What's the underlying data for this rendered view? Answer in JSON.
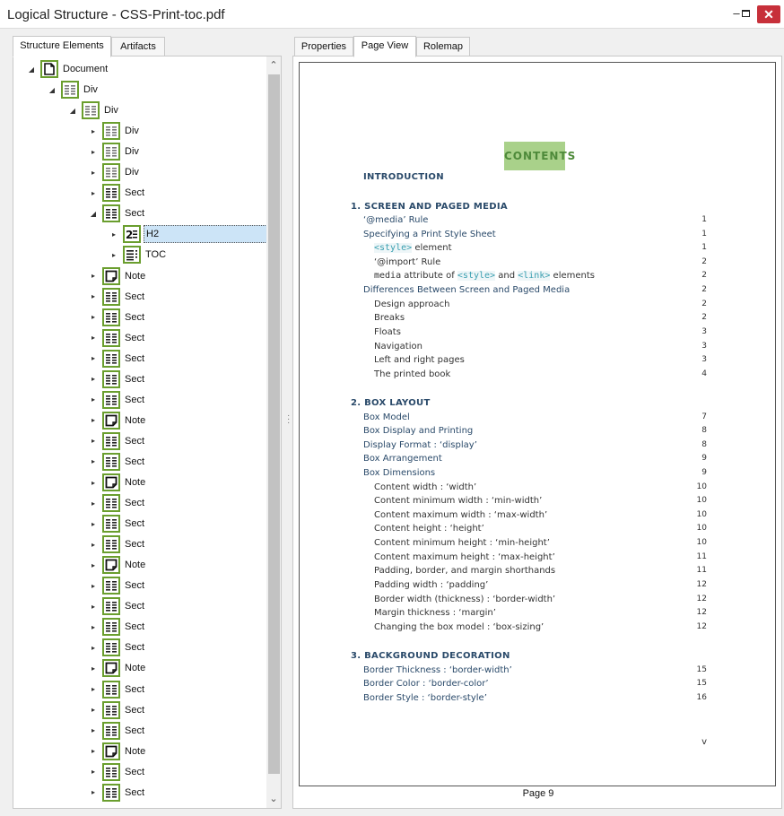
{
  "window": {
    "title": "Logical Structure - CSS-Print-toc.pdf",
    "minimize": "–",
    "close": "✕"
  },
  "left_tabs": [
    "Structure Elements",
    "Artifacts"
  ],
  "right_tabs": [
    "Properties",
    "Page View",
    "Rolemap"
  ],
  "tree": [
    {
      "label": "Document",
      "icon": "document-icon",
      "depth": 0,
      "expander": "◢"
    },
    {
      "label": "Div",
      "icon": "div-icon",
      "depth": 1,
      "expander": "◢"
    },
    {
      "label": "Div",
      "icon": "div-icon",
      "depth": 2,
      "expander": "◢"
    },
    {
      "label": "Div",
      "icon": "div-icon",
      "depth": 3,
      "expander": "▸"
    },
    {
      "label": "Div",
      "icon": "div-icon",
      "depth": 3,
      "expander": "▸"
    },
    {
      "label": "Div",
      "icon": "div-icon",
      "depth": 3,
      "expander": "▸"
    },
    {
      "label": "Sect",
      "icon": "sect-icon",
      "depth": 3,
      "expander": "▸"
    },
    {
      "label": "Sect",
      "icon": "sect-icon",
      "depth": 3,
      "expander": "◢"
    },
    {
      "label": "H2",
      "icon": "heading-icon",
      "depth": 4,
      "expander": "▸",
      "selected": true
    },
    {
      "label": "TOC",
      "icon": "toc-icon",
      "depth": 4,
      "expander": "▸"
    },
    {
      "label": "Note",
      "icon": "note-icon",
      "depth": 3,
      "expander": "▸"
    },
    {
      "label": "Sect",
      "icon": "sect-icon",
      "depth": 3,
      "expander": "▸"
    },
    {
      "label": "Sect",
      "icon": "sect-icon",
      "depth": 3,
      "expander": "▸"
    },
    {
      "label": "Sect",
      "icon": "sect-icon",
      "depth": 3,
      "expander": "▸"
    },
    {
      "label": "Sect",
      "icon": "sect-icon",
      "depth": 3,
      "expander": "▸"
    },
    {
      "label": "Sect",
      "icon": "sect-icon",
      "depth": 3,
      "expander": "▸"
    },
    {
      "label": "Sect",
      "icon": "sect-icon",
      "depth": 3,
      "expander": "▸"
    },
    {
      "label": "Note",
      "icon": "note-icon",
      "depth": 3,
      "expander": "▸"
    },
    {
      "label": "Sect",
      "icon": "sect-icon",
      "depth": 3,
      "expander": "▸"
    },
    {
      "label": "Sect",
      "icon": "sect-icon",
      "depth": 3,
      "expander": "▸"
    },
    {
      "label": "Note",
      "icon": "note-icon",
      "depth": 3,
      "expander": "▸"
    },
    {
      "label": "Sect",
      "icon": "sect-icon",
      "depth": 3,
      "expander": "▸"
    },
    {
      "label": "Sect",
      "icon": "sect-icon",
      "depth": 3,
      "expander": "▸"
    },
    {
      "label": "Sect",
      "icon": "sect-icon",
      "depth": 3,
      "expander": "▸"
    },
    {
      "label": "Note",
      "icon": "note-icon",
      "depth": 3,
      "expander": "▸"
    },
    {
      "label": "Sect",
      "icon": "sect-icon",
      "depth": 3,
      "expander": "▸"
    },
    {
      "label": "Sect",
      "icon": "sect-icon",
      "depth": 3,
      "expander": "▸"
    },
    {
      "label": "Sect",
      "icon": "sect-icon",
      "depth": 3,
      "expander": "▸"
    },
    {
      "label": "Sect",
      "icon": "sect-icon",
      "depth": 3,
      "expander": "▸"
    },
    {
      "label": "Note",
      "icon": "note-icon",
      "depth": 3,
      "expander": "▸"
    },
    {
      "label": "Sect",
      "icon": "sect-icon",
      "depth": 3,
      "expander": "▸"
    },
    {
      "label": "Sect",
      "icon": "sect-icon",
      "depth": 3,
      "expander": "▸"
    },
    {
      "label": "Sect",
      "icon": "sect-icon",
      "depth": 3,
      "expander": "▸"
    },
    {
      "label": "Note",
      "icon": "note-icon",
      "depth": 3,
      "expander": "▸"
    },
    {
      "label": "Sect",
      "icon": "sect-icon",
      "depth": 3,
      "expander": "▸"
    },
    {
      "label": "Sect",
      "icon": "sect-icon",
      "depth": 3,
      "expander": "▸"
    }
  ],
  "page_view": {
    "heading": "CONTENTS",
    "footer": "Page 9",
    "roman_page": "v",
    "entries": [
      {
        "text": "INTRODUCTION",
        "style": "h",
        "page": ""
      },
      {
        "text": "1. SCREEN AND PAGED MEDIA",
        "style": "h",
        "page": ""
      },
      {
        "text": "‘@media’ Rule",
        "style": "l1",
        "page": "1"
      },
      {
        "text": "Specifying a Print Style Sheet",
        "style": "l1",
        "page": "1"
      },
      {
        "parts": [
          [
            "code",
            "<style>"
          ],
          [
            "txt",
            " element"
          ]
        ],
        "style": "l2",
        "page": "1"
      },
      {
        "text": "‘@import’ Rule",
        "style": "l2",
        "page": "2"
      },
      {
        "parts": [
          [
            "mono",
            "media"
          ],
          [
            "txt",
            " attribute of "
          ],
          [
            "code",
            "<style>"
          ],
          [
            "txt",
            " and "
          ],
          [
            "code",
            "<link>"
          ],
          [
            "txt",
            " elements"
          ]
        ],
        "style": "l2",
        "page": "2"
      },
      {
        "text": "Differences Between Screen and Paged Media",
        "style": "l1",
        "page": "2"
      },
      {
        "text": "Design approach",
        "style": "l2",
        "page": "2"
      },
      {
        "text": "Breaks",
        "style": "l2",
        "page": "2"
      },
      {
        "text": "Floats",
        "style": "l2",
        "page": "3"
      },
      {
        "text": "Navigation",
        "style": "l2",
        "page": "3"
      },
      {
        "text": "Left and right pages",
        "style": "l2",
        "page": "3"
      },
      {
        "text": "The printed book",
        "style": "l2",
        "page": "4"
      },
      {
        "text": "2. BOX LAYOUT",
        "style": "h",
        "page": ""
      },
      {
        "text": "Box Model",
        "style": "l1",
        "page": "7"
      },
      {
        "text": "Box Display and Printing",
        "style": "l1",
        "page": "8"
      },
      {
        "text": "Display Format : ‘display’",
        "style": "l1",
        "page": "8"
      },
      {
        "text": "Box Arrangement",
        "style": "l1",
        "page": "9"
      },
      {
        "text": "Box Dimensions",
        "style": "l1",
        "page": "9"
      },
      {
        "text": "Content width : ‘width’",
        "style": "l2",
        "page": "10"
      },
      {
        "text": "Content minimum width : ‘min-width’",
        "style": "l2",
        "page": "10"
      },
      {
        "text": "Content maximum width : ‘max-width’",
        "style": "l2",
        "page": "10"
      },
      {
        "text": "Content height : ‘height’",
        "style": "l2",
        "page": "10"
      },
      {
        "text": "Content minimum height : ‘min-height’",
        "style": "l2",
        "page": "10"
      },
      {
        "text": "Content maximum height : ‘max-height’",
        "style": "l2",
        "page": "11"
      },
      {
        "text": "Padding, border, and margin shorthands",
        "style": "l2",
        "page": "11"
      },
      {
        "text": "Padding width : ‘padding’",
        "style": "l2",
        "page": "12"
      },
      {
        "text": "Border width (thickness) : ‘border-width’",
        "style": "l2",
        "page": "12"
      },
      {
        "text": "Margin thickness : ‘margin’",
        "style": "l2",
        "page": "12"
      },
      {
        "text": "Changing the box model : ‘box-sizing’",
        "style": "l2",
        "page": "12"
      },
      {
        "text": "3. BACKGROUND DECORATION",
        "style": "h",
        "page": ""
      },
      {
        "text": "Border Thickness : ‘border-width’",
        "style": "l1",
        "page": "15"
      },
      {
        "text": "Border Color : ‘border-color’",
        "style": "l1",
        "page": "15"
      },
      {
        "text": "Border Style : ‘border-style’",
        "style": "l1",
        "page": "16"
      }
    ]
  },
  "colors": {
    "icon_border": "#6a9e2e",
    "heading_bg": "#a9d18a",
    "selection": "#cce4f7",
    "close_button": "#c7303a"
  }
}
